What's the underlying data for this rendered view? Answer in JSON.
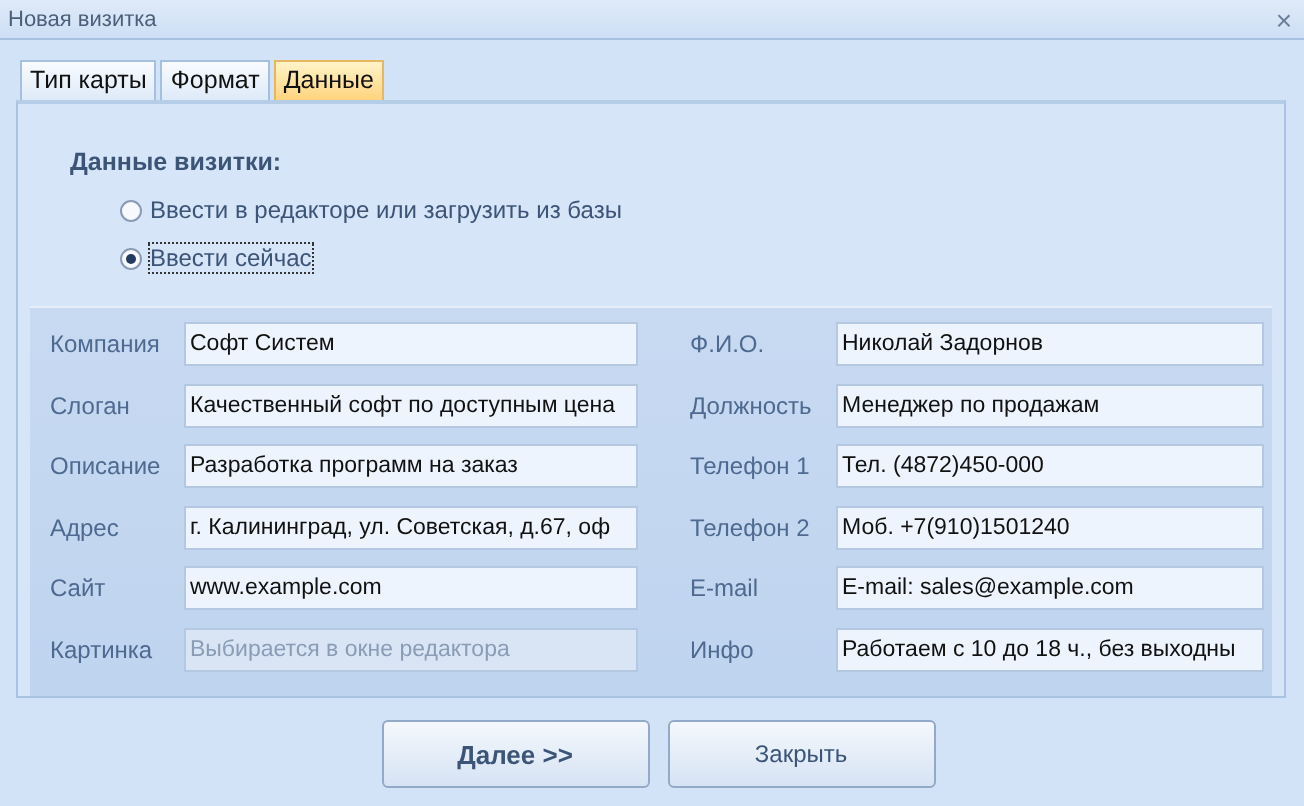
{
  "window": {
    "title": "Новая визитка",
    "close": "×"
  },
  "tabs": [
    {
      "label": "Тип карты",
      "selected": false
    },
    {
      "label": "Формат",
      "selected": false
    },
    {
      "label": "Данные",
      "selected": true
    }
  ],
  "section_title": "Данные визитки:",
  "radios": [
    {
      "label": "Ввести в редакторе или загрузить из базы",
      "selected": false
    },
    {
      "label": "Ввести сейчас",
      "selected": true
    }
  ],
  "fields_left": [
    {
      "label": "Компания",
      "value": "Софт Систем",
      "disabled": false
    },
    {
      "label": "Слоган",
      "value": "Качественный софт по доступным цена",
      "disabled": false
    },
    {
      "label": "Описание",
      "value": "Разработка программ на заказ",
      "disabled": false
    },
    {
      "label": "Адрес",
      "value": "г. Калининград, ул. Советская, д.67, оф",
      "disabled": false
    },
    {
      "label": "Сайт",
      "value": "www.example.com",
      "disabled": false
    },
    {
      "label": "Картинка",
      "value": "Выбирается в окне редактора",
      "disabled": true
    }
  ],
  "fields_right": [
    {
      "label": "Ф.И.О.",
      "value": "Николай Задорнов",
      "disabled": false
    },
    {
      "label": "Должность",
      "value": "Менеджер по продажам",
      "disabled": false
    },
    {
      "label": "Телефон 1",
      "value": "Тел. (4872)450-000",
      "disabled": false
    },
    {
      "label": "Телефон 2",
      "value": "Моб. +7(910)1501240",
      "disabled": false
    },
    {
      "label": "E-mail",
      "value": "E-mail: sales@example.com",
      "disabled": false
    },
    {
      "label": "Инфо",
      "value": "Работаем с 10 до 18 ч., без выходны",
      "disabled": false
    }
  ],
  "buttons": [
    {
      "label": "Далее >>",
      "kind": "primary"
    },
    {
      "label": "Закрыть",
      "kind": "normal"
    }
  ]
}
